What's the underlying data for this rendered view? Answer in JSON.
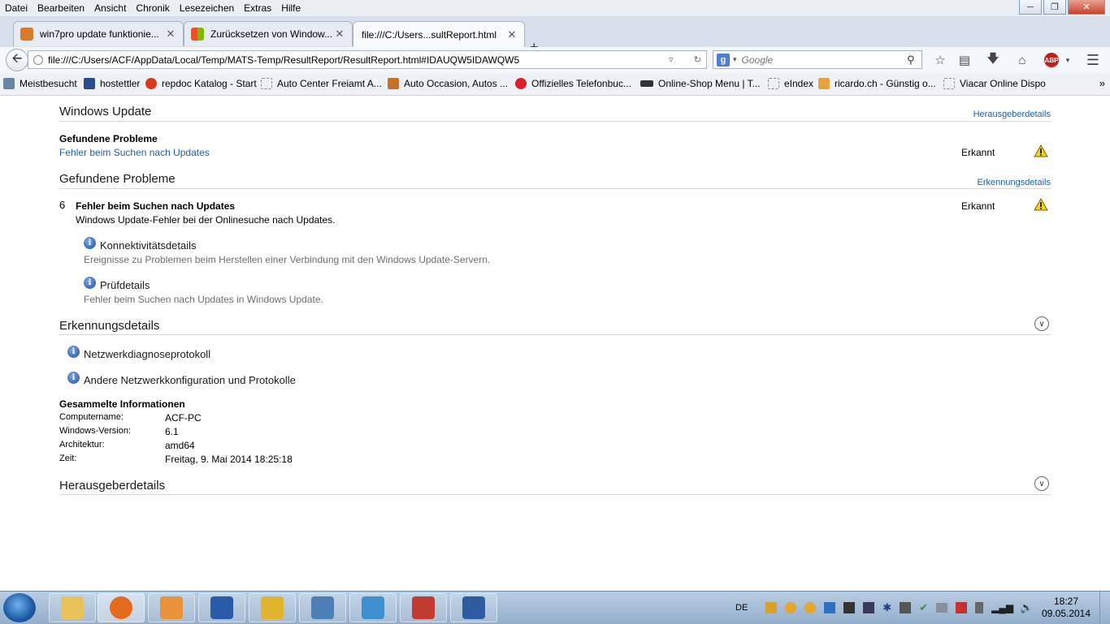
{
  "menu": [
    "Datei",
    "Bearbeiten",
    "Ansicht",
    "Chronik",
    "Lesezeichen",
    "Extras",
    "Hilfe"
  ],
  "tabs": [
    {
      "label": "win7pro update funktionie...",
      "color": "#d97a2b"
    },
    {
      "label": "Zurücksetzen von Window...",
      "color": "#3b8fd8"
    },
    {
      "label": "file:///C:/Users...sultReport.html",
      "color": "#ffffff"
    }
  ],
  "url": "file:///C:/Users/ACF/AppData/Local/Temp/MATS-Temp/ResultReport/ResultReport.html#IDAUQW5IDAWQW5",
  "search_placeholder": "Google",
  "bookmarks": [
    {
      "label": "Meistbesucht",
      "color": "#6a84a8"
    },
    {
      "label": "hostettler",
      "color": "#2b4c8a"
    },
    {
      "label": "repdoc Katalog - Start",
      "color": "#d63a1b"
    },
    {
      "label": "Auto Center Freiamt A...",
      "color": "#ffffff"
    },
    {
      "label": "Auto Occasion, Autos ...",
      "color": "#c7702a"
    },
    {
      "label": "Offizielles Telefonbuc...",
      "color": "#d8202b"
    },
    {
      "label": "Online-Shop Menu | T...",
      "color": "#333333"
    },
    {
      "label": "eIndex",
      "color": "#ffffff"
    },
    {
      "label": "ricardo.ch - Günstig o...",
      "color": "#e6a23c"
    },
    {
      "label": "Viacar Online Dispo",
      "color": "#ffffff"
    }
  ],
  "content": {
    "s1_title": "Windows Update",
    "s1_link": "Herausgeberdetails",
    "s1_problems_heading": "Gefundene Probleme",
    "s1_problem_link": "Fehler beim Suchen nach Updates",
    "s1_status": "Erkannt",
    "s2_title": "Gefundene Probleme",
    "s2_link": "Erkennungsdetails",
    "problem_number": "6",
    "problem_title": "Fehler beim Suchen nach Updates",
    "problem_status": "Erkannt",
    "problem_desc": "Windows Update-Fehler bei der Onlinesuche nach Updates.",
    "detail1_title": "Konnektivitätsdetails",
    "detail1_desc": "Ereignisse zu Problemen beim Herstellen einer Verbindung mit den Windows Update-Servern.",
    "detail2_title": "Prüfdetails",
    "detail2_desc": "Fehler beim Suchen nach Updates in Windows Update.",
    "s3_title": "Erkennungsdetails",
    "log1": "Netzwerkdiagnoseprotokoll",
    "log2": "Andere Netzwerkkonfiguration und Protokolle",
    "info_heading": "Gesammelte Informationen",
    "info_rows": [
      {
        "label": "Computername:",
        "value": "ACF-PC"
      },
      {
        "label": "Windows-Version:",
        "value": "6.1"
      },
      {
        "label": "Architektur:",
        "value": "amd64"
      },
      {
        "label": "Zeit:",
        "value": "Freitag, 9. Mai 2014 18:25:18"
      }
    ],
    "s4_title": "Herausgeberdetails"
  },
  "taskbar": {
    "apps": [
      {
        "name": "explorer",
        "color": "#e8c25a"
      },
      {
        "name": "firefox",
        "color": "#e36b1e"
      },
      {
        "name": "media-player",
        "color": "#e8923a"
      },
      {
        "name": "word",
        "color": "#2a5ba8"
      },
      {
        "name": "tools",
        "color": "#e2b32c"
      },
      {
        "name": "window",
        "color": "#4b7fb5"
      },
      {
        "name": "control-panel",
        "color": "#3d8fd0"
      },
      {
        "name": "toolbox",
        "color": "#c23a32"
      },
      {
        "name": "support",
        "color": "#2f5c9e"
      }
    ],
    "lang": "DE",
    "time": "18:27",
    "date": "09.05.2014"
  }
}
